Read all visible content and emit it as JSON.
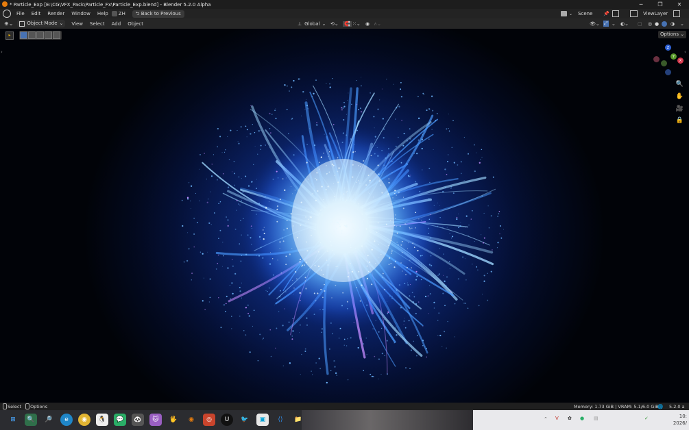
{
  "window": {
    "title": "* Particle_Exp [E:\\CG\\VFX_Pack\\Particle_Fx\\Particle_Exp.blend] - Blender 5.2.0 Alpha"
  },
  "menubar": {
    "items": [
      "File",
      "Edit",
      "Render",
      "Window",
      "Help"
    ],
    "lang": "ZH",
    "back_button": "Back to Previous",
    "scene": "Scene",
    "view_layer": "ViewLayer"
  },
  "viewport_header": {
    "mode": "Object Mode",
    "menus": [
      "View",
      "Select",
      "Add",
      "Object"
    ],
    "orientation": "Global",
    "options": "Options"
  },
  "status": {
    "select": "Select",
    "options": "Options",
    "memory": "Memory: 1.73 GiB | VRAM: 5.1/6.0 GiB",
    "version": "5.2.0 a"
  },
  "taskbar": {
    "clock_time": "10:",
    "clock_date": "2026/"
  },
  "gizmo": {
    "z": "Z",
    "y": "Y",
    "x": "X"
  },
  "colors": {
    "accent_blue": "#4772b3",
    "particle_core": "#e8f6ff",
    "particle_glow": "#4aa0ff"
  }
}
